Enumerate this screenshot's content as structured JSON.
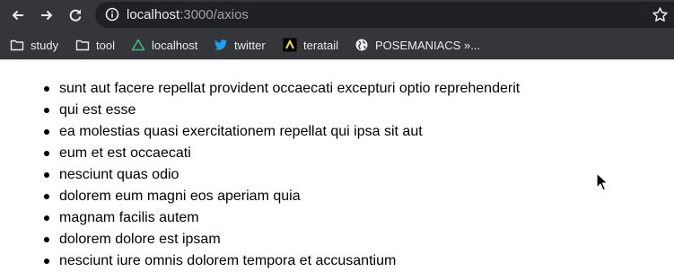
{
  "browser": {
    "url_host": "localhost",
    "url_path": ":3000/axios",
    "bookmarks": [
      {
        "label": "study",
        "icon": "folder-icon"
      },
      {
        "label": "tool",
        "icon": "folder-icon"
      },
      {
        "label": "localhost",
        "icon": "triangle-logo-icon"
      },
      {
        "label": "twitter",
        "icon": "twitter-bird-icon"
      },
      {
        "label": "teratail",
        "icon": "teratail-logo-icon"
      },
      {
        "label": "POSEMANIACS »...",
        "icon": "globe-icon"
      }
    ]
  },
  "posts": [
    "sunt aut facere repellat provident occaecati excepturi optio reprehenderit",
    "qui est esse",
    "ea molestias quasi exercitationem repellat qui ipsa sit aut",
    "eum et est occaecati",
    "nesciunt quas odio",
    "dolorem eum magni eos aperiam quia",
    "magnam facilis autem",
    "dolorem dolore est ipsam",
    "nesciunt iure omnis dolorem tempora et accusantium"
  ],
  "colors": {
    "chrome_bg": "#35363a",
    "omnibox_bg": "#202124",
    "twitter_blue": "#1da1f2",
    "teratail_yellow": "#f8d84a"
  }
}
